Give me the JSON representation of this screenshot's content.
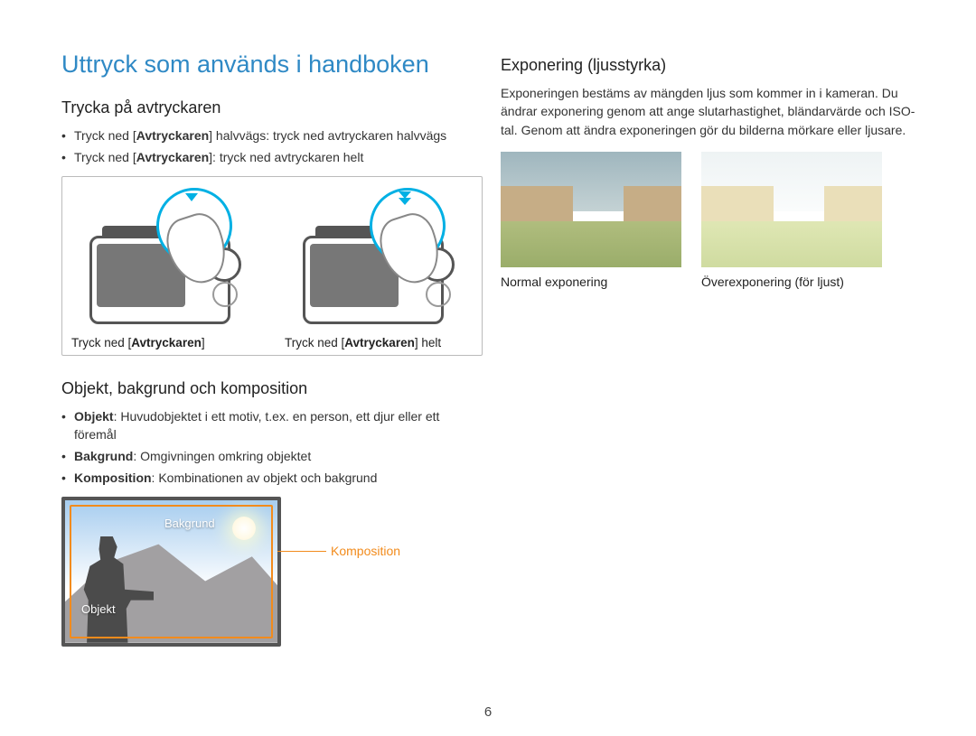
{
  "pageNumber": "6",
  "left": {
    "title": "Uttryck som används i handboken",
    "section1": {
      "heading": "Trycka på avtryckaren",
      "bullets": [
        {
          "pre": "Tryck ned [",
          "bold": "Avtryckaren",
          "post": "] halvvägs: tryck ned avtryckaren halvvägs"
        },
        {
          "pre": "Tryck ned [",
          "bold": "Avtryckaren",
          "post": "]: tryck ned avtryckaren helt"
        }
      ],
      "captions": [
        {
          "pre": "Tryck ned [",
          "bold": "Avtryckaren",
          "post": "]"
        },
        {
          "pre": "Tryck ned [",
          "bold": "Avtryckaren",
          "post": "] helt"
        }
      ]
    },
    "section2": {
      "heading": "Objekt, bakgrund och komposition",
      "bullets": [
        {
          "bold": "Objekt",
          "post": ": Huvudobjektet i ett motiv, t.ex. en person, ett djur eller ett föremål"
        },
        {
          "bold": "Bakgrund",
          "post": ": Omgivningen omkring objektet"
        },
        {
          "bold": "Komposition",
          "post": ": Kombinationen av objekt och bakgrund"
        }
      ],
      "diagram": {
        "bakgrund": "Bakgrund",
        "objekt": "Objekt",
        "komposition": "Komposition"
      }
    }
  },
  "right": {
    "heading": "Exponering (ljusstyrka)",
    "paragraph": "Exponeringen bestäms av mängden ljus som kommer in i kameran. Du ändrar exponering genom att ange slutarhastighet, bländarvärde och ISO-tal. Genom att ändra exponeringen gör du bilderna mörkare eller ljusare.",
    "photos": {
      "normal": "Normal exponering",
      "over": "Överexponering (för ljust)"
    }
  }
}
